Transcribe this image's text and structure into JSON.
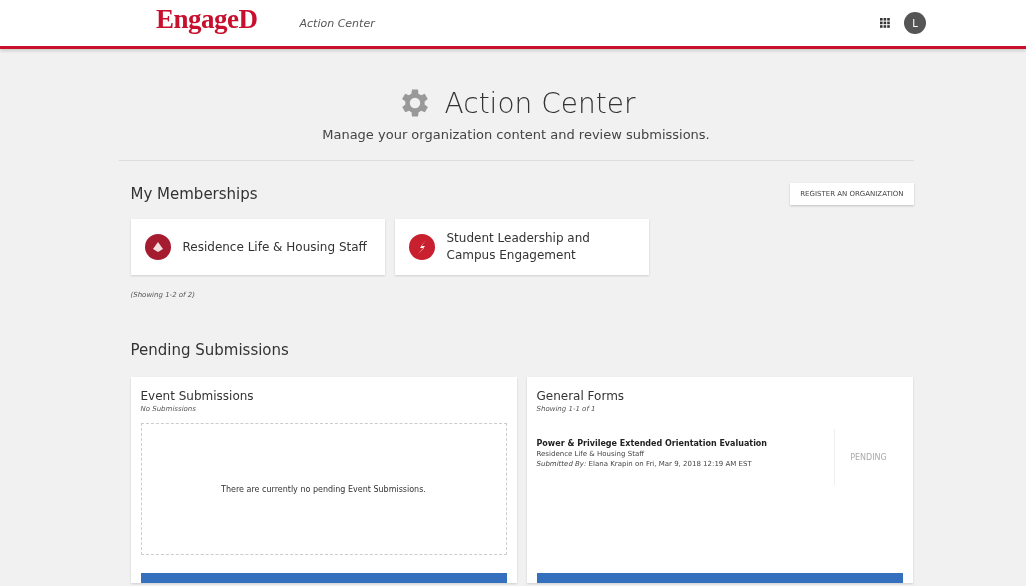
{
  "header": {
    "logo": "EngageD",
    "section": "Action Center",
    "avatar_initial": "L"
  },
  "hero": {
    "title": "Action Center",
    "subtitle": "Manage your organization content and review submissions."
  },
  "memberships": {
    "title": "My Memberships",
    "register_button": "REGISTER AN ORGANIZATION",
    "items": [
      {
        "name": "Residence Life & Housing Staff",
        "kind": "crest"
      },
      {
        "name": "Student Leadership and Campus Engagement",
        "kind": "bolt"
      }
    ],
    "count": "(Showing 1-2 of 2)"
  },
  "pending": {
    "title": "Pending Submissions",
    "panels": [
      {
        "title": "Event Submissions",
        "subtitle": "No Submissions",
        "empty_text": "There are currently no pending Event Submissions."
      },
      {
        "title": "General Forms",
        "subtitle": "Showing 1-1 of 1",
        "items": [
          {
            "title": "Power & Privilege Extended Orientation Evaluation",
            "org": "Residence Life & Housing Staff",
            "submitted": "*Submitted By:* Elana Krapin on Fri, Mar 9, 2018 12:19 AM EST",
            "status": "PENDING"
          }
        ]
      }
    ]
  }
}
